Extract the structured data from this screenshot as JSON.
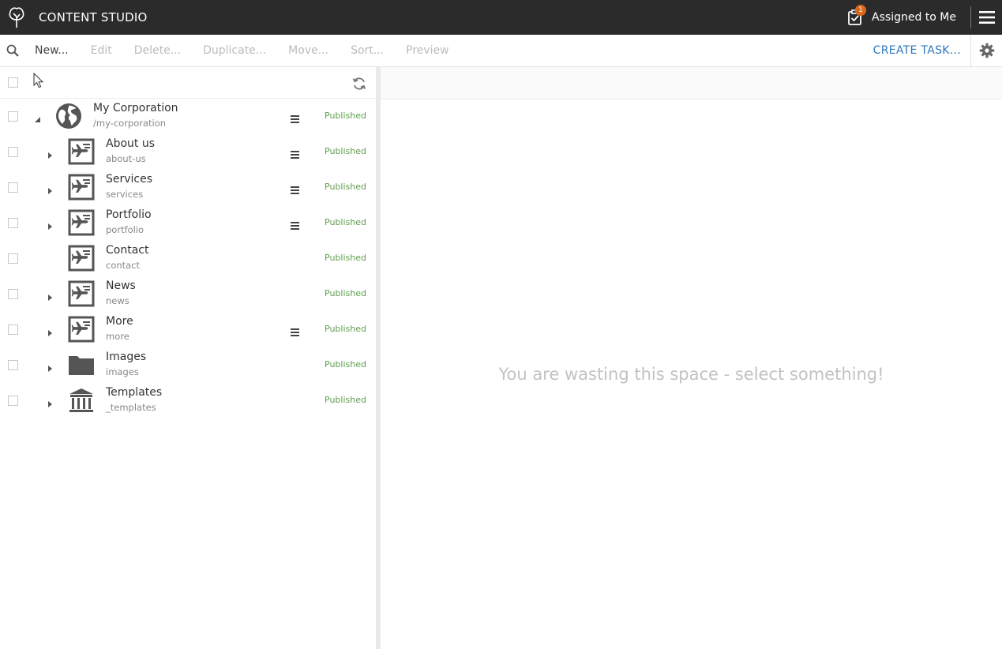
{
  "app": {
    "title": "CONTENT STUDIO"
  },
  "topbar": {
    "tasks_label": "Assigned to Me",
    "tasks_count": "1"
  },
  "toolbar": {
    "buttons": [
      "New...",
      "Edit",
      "Delete...",
      "Duplicate...",
      "Move...",
      "Sort...",
      "Preview"
    ],
    "create_task": "CREATE TASK..."
  },
  "tree": {
    "items": [
      {
        "name": "My Corporation",
        "path": "/my-corporation",
        "status": "Published",
        "icon": "globe-icon",
        "expanded": true,
        "has_children": true,
        "has_menu": true,
        "level": 0
      },
      {
        "name": "About us",
        "path": "about-us",
        "status": "Published",
        "icon": "page-icon",
        "has_children": true,
        "has_menu": true,
        "level": 1
      },
      {
        "name": "Services",
        "path": "services",
        "status": "Published",
        "icon": "page-icon",
        "has_children": true,
        "has_menu": true,
        "level": 1
      },
      {
        "name": "Portfolio",
        "path": "portfolio",
        "status": "Published",
        "icon": "page-icon",
        "has_children": true,
        "has_menu": true,
        "level": 1
      },
      {
        "name": "Contact",
        "path": "contact",
        "status": "Published",
        "icon": "page-icon",
        "has_children": false,
        "has_menu": false,
        "level": 1
      },
      {
        "name": "News",
        "path": "news",
        "status": "Published",
        "icon": "page-icon",
        "has_children": true,
        "has_menu": false,
        "level": 1
      },
      {
        "name": "More",
        "path": "more",
        "status": "Published",
        "icon": "page-icon",
        "has_children": true,
        "has_menu": true,
        "level": 1
      },
      {
        "name": "Images",
        "path": "images",
        "status": "Published",
        "icon": "folder-icon",
        "has_children": true,
        "has_menu": false,
        "level": 1
      },
      {
        "name": "Templates",
        "path": "_templates",
        "status": "Published",
        "icon": "templates-icon",
        "has_children": true,
        "has_menu": false,
        "level": 1
      }
    ]
  },
  "detail": {
    "empty_message": "You are wasting this space - select something!"
  },
  "colors": {
    "topbar": "#2b2b2b",
    "status_published": "#609e4f",
    "link": "#2c76be",
    "badge": "#d9691a"
  }
}
